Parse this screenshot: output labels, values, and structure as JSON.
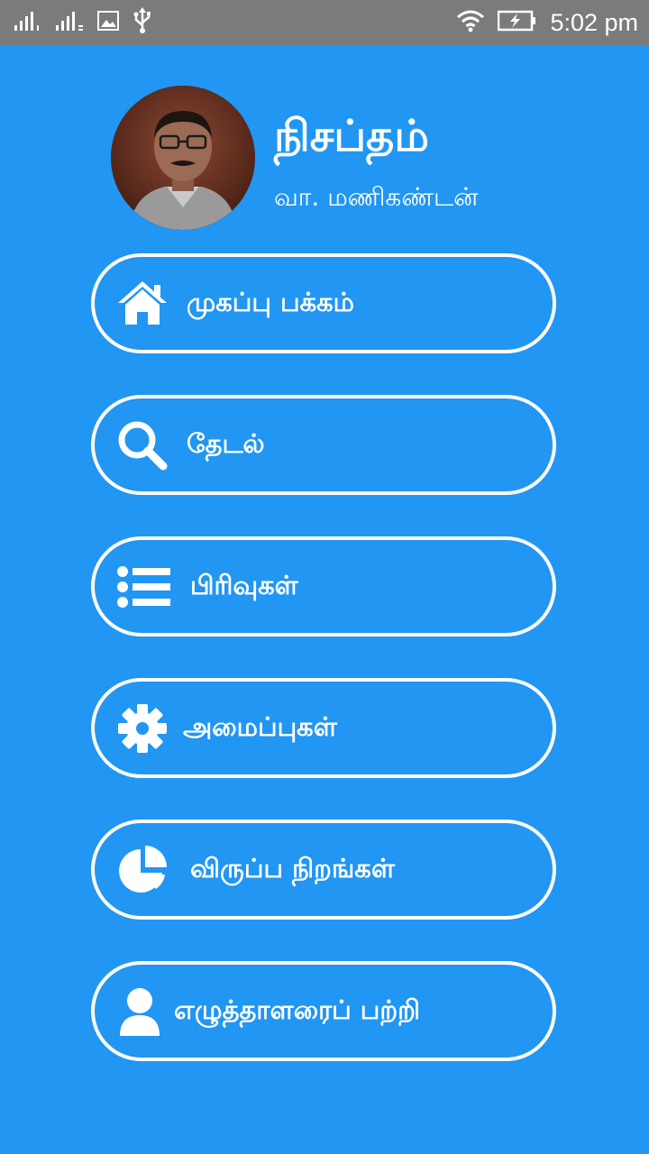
{
  "status_bar": {
    "time": "5:02 pm",
    "icons": [
      "signal-sim1-icon",
      "signal-sim2-icon",
      "image-notification-icon",
      "usb-icon",
      "wifi-icon",
      "battery-charging-icon"
    ]
  },
  "header": {
    "title": "நிசப்தம்",
    "author": "வா. மணிகண்டன்"
  },
  "menu": {
    "items": [
      {
        "label": "முகப்பு பக்கம்",
        "icon": "home-icon"
      },
      {
        "label": "தேடல்",
        "icon": "search-icon"
      },
      {
        "label": "பிரிவுகள்",
        "icon": "list-icon"
      },
      {
        "label": "அமைப்புகள்",
        "icon": "gear-icon"
      },
      {
        "label": "விருப்ப நிறங்கள்",
        "icon": "pie-chart-icon"
      },
      {
        "label": "எழுத்தாளரைப் பற்றி",
        "icon": "user-icon"
      }
    ]
  },
  "colors": {
    "background": "#2196F3",
    "status_bar": "#7b7b7b",
    "foreground": "#FFFFFF"
  }
}
